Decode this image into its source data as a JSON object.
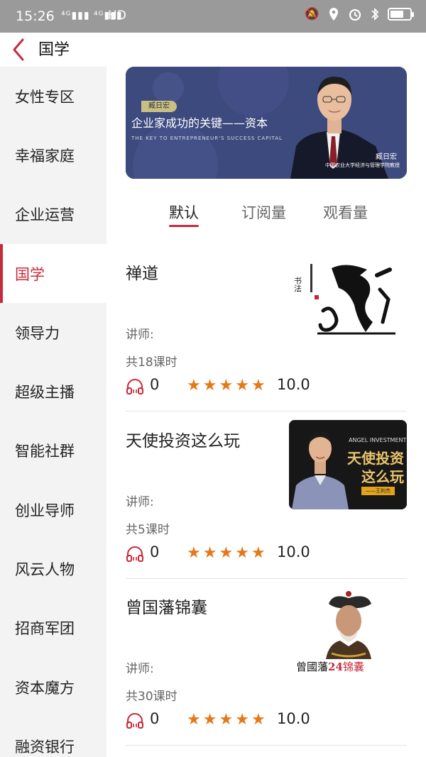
{
  "status_bar": {
    "time": "15:26",
    "signal": "⁴ᴳ▮▮▮ ⁴ᴳ▮▮▮",
    "network_label": "HD",
    "icons": [
      "mute-icon",
      "location-icon",
      "alarm-icon",
      "bluetooth-icon",
      "battery-icon"
    ],
    "battery_level": 0.7
  },
  "nav": {
    "title": "国学"
  },
  "sidebar": {
    "items": [
      {
        "label": "女性专区"
      },
      {
        "label": "幸福家庭"
      },
      {
        "label": "企业运营"
      },
      {
        "label": "国学"
      },
      {
        "label": "领导力"
      },
      {
        "label": "超级主播"
      },
      {
        "label": "智能社群"
      },
      {
        "label": "创业导师"
      },
      {
        "label": "风云人物"
      },
      {
        "label": "招商军团"
      },
      {
        "label": "资本魔方"
      },
      {
        "label": "融资银行"
      }
    ],
    "active_index": 3
  },
  "banner": {
    "tag": "臧日宏",
    "title": "企业家成功的关键——资本",
    "subtitle": "THE KEY TO ENTREPRENEUR'S SUCCESS CAPITAL",
    "person_name": "臧日宏",
    "person_title": "中国农业大学经济与管理学院教授"
  },
  "tabs": [
    {
      "label": "默认",
      "active": true
    },
    {
      "label": "订阅量",
      "active": false
    },
    {
      "label": "观看量",
      "active": false
    }
  ],
  "courses": [
    {
      "title": "禅道",
      "teacher": "讲师:",
      "lessons": "共18课时",
      "listens": "0",
      "stars": 5,
      "rating": "10.0",
      "image": {
        "type": "calligraphy",
        "text": "禅道"
      }
    },
    {
      "title": "天使投资这么玩",
      "teacher": "讲师:",
      "lessons": "共5课时",
      "listens": "0",
      "stars": 5,
      "rating": "10.0",
      "image": {
        "type": "poster",
        "caption_en": "ANGEL INVESTMENT",
        "caption_cn_1": "天使投资",
        "caption_cn_2": "这么玩",
        "author": "——王利杰"
      }
    },
    {
      "title": "曾国藩锦囊",
      "teacher": "讲师:",
      "lessons": "共30课时",
      "listens": "0",
      "stars": 5,
      "rating": "10.0",
      "image": {
        "type": "portrait",
        "caption_a": "曾國藩",
        "caption_b": "24",
        "caption_c": "锦囊"
      }
    }
  ],
  "colors": {
    "accent": "#c82a3a",
    "star": "#e67817",
    "banner_bg": "#3d4a7e",
    "status_bar": "#9a9a9a"
  }
}
